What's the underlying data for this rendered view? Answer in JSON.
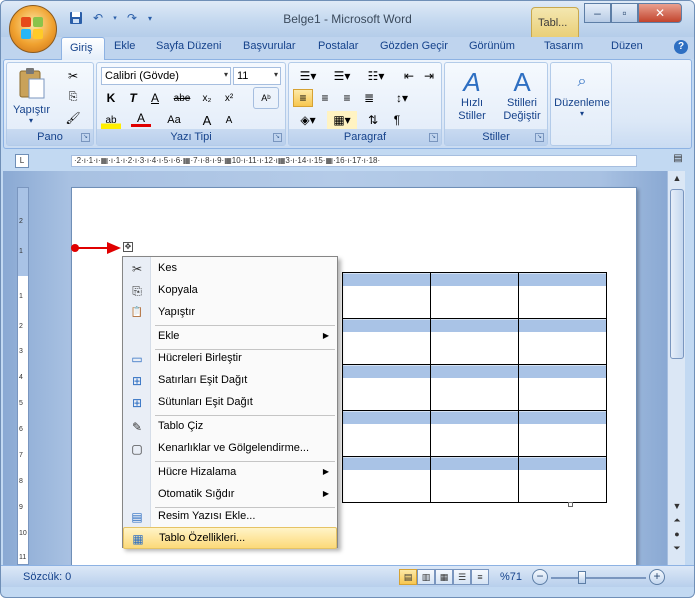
{
  "window": {
    "title": "Belge1 - Microsoft Word",
    "context_tab": "Tabl..."
  },
  "quick_access": [
    "save-icon",
    "undo-icon",
    "redo-icon",
    "customize-icon"
  ],
  "ribbon_tabs": [
    "Giriş",
    "Ekle",
    "Sayfa Düzeni",
    "Başvurular",
    "Postalar",
    "Gözden Geçir",
    "Görünüm",
    "Tasarım",
    "Düzen"
  ],
  "ribbon": {
    "clipboard": {
      "paste_label": "Yapıştır",
      "group_label": "Pano"
    },
    "font": {
      "font_name": "Calibri (Gövde)",
      "font_size": "11",
      "group_label": "Yazı Tipi"
    },
    "paragraph": {
      "group_label": "Paragraf"
    },
    "styles": {
      "quick_styles": "Hızlı Stiller",
      "change_styles": "Stilleri Değiştir",
      "group_label": "Stiller"
    },
    "editing": {
      "label": "Düzenleme"
    }
  },
  "ruler": {
    "text": "·2·ı·1·ı·▦·ı·1·ı·2·ı·3·ı·4·ı·5·ı·6·▦·7·ı·8·ı·9·▦10·ı·11·ı·12·ı▦3·ı·14·ı·15·▦·16·ı·17·ı·18·"
  },
  "context_menu": {
    "items": [
      {
        "label": "Kes",
        "icon": "scissors-icon",
        "glyph": "✂",
        "submenu": false
      },
      {
        "label": "Kopyala",
        "icon": "copy-icon",
        "glyph": "⎘",
        "submenu": false
      },
      {
        "label": "Yapıştır",
        "icon": "paste-icon",
        "glyph": "📋",
        "submenu": false
      },
      {
        "label": "Ekle",
        "icon": "",
        "glyph": "",
        "submenu": true
      },
      {
        "label": "Hücreleri Birleştir",
        "icon": "merge-cells-icon",
        "glyph": "▭",
        "submenu": false
      },
      {
        "label": "Satırları Eşit Dağıt",
        "icon": "distribute-rows-icon",
        "glyph": "⊞",
        "submenu": false
      },
      {
        "label": "Sütunları Eşit Dağıt",
        "icon": "distribute-columns-icon",
        "glyph": "⊞",
        "submenu": false
      },
      {
        "label": "Tablo Çiz",
        "icon": "draw-table-icon",
        "glyph": "✎",
        "submenu": false
      },
      {
        "label": "Kenarlıklar ve Gölgelendirme...",
        "icon": "borders-icon",
        "glyph": "▢",
        "submenu": false
      },
      {
        "label": "Hücre Hizalama",
        "icon": "",
        "glyph": "",
        "submenu": true
      },
      {
        "label": "Otomatik Sığdır",
        "icon": "",
        "glyph": "",
        "submenu": true
      },
      {
        "label": "Resim Yazısı Ekle...",
        "icon": "caption-icon",
        "glyph": "▤",
        "submenu": false
      },
      {
        "label": "Tablo Özellikleri...",
        "icon": "table-properties-icon",
        "glyph": "▦",
        "submenu": false
      }
    ]
  },
  "statusbar": {
    "words": "Sözcük: 0",
    "zoom": "%71"
  },
  "colors": {
    "accent": "#15428b",
    "selection": "#a9c3e6",
    "highlight": "#fcd979",
    "arrow": "#e00000"
  }
}
